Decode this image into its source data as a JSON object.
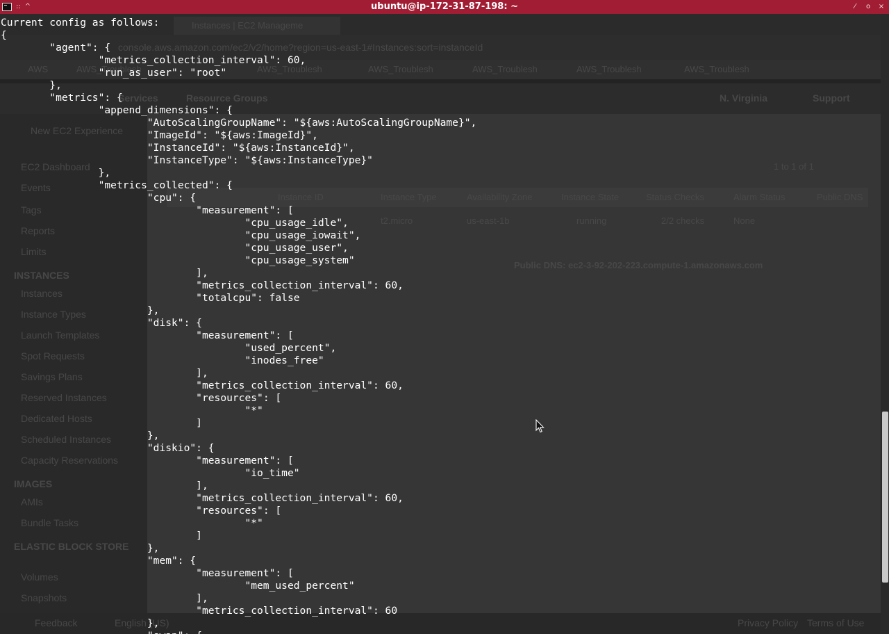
{
  "window": {
    "title": "ubuntu@ip-172-31-87-198: ~",
    "menu_glyph": "::",
    "pin_glyph": "^",
    "minimize_glyph": "⁄",
    "maximize_glyph": "o",
    "close_glyph": "×"
  },
  "terminal": {
    "lines": [
      "Current config as follows:",
      "{",
      "\t\"agent\": {",
      "\t\t\"metrics_collection_interval\": 60,",
      "\t\t\"run_as_user\": \"root\"",
      "\t},",
      "\t\"metrics\": {",
      "\t\t\"append_dimensions\": {",
      "\t\t\t\"AutoScalingGroupName\": \"${aws:AutoScalingGroupName}\",",
      "\t\t\t\"ImageId\": \"${aws:ImageId}\",",
      "\t\t\t\"InstanceId\": \"${aws:InstanceId}\",",
      "\t\t\t\"InstanceType\": \"${aws:InstanceType}\"",
      "\t\t},",
      "\t\t\"metrics_collected\": {",
      "\t\t\t\"cpu\": {",
      "\t\t\t\t\"measurement\": [",
      "\t\t\t\t\t\"cpu_usage_idle\",",
      "\t\t\t\t\t\"cpu_usage_iowait\",",
      "\t\t\t\t\t\"cpu_usage_user\",",
      "\t\t\t\t\t\"cpu_usage_system\"",
      "\t\t\t\t],",
      "\t\t\t\t\"metrics_collection_interval\": 60,",
      "\t\t\t\t\"totalcpu\": false",
      "\t\t\t},",
      "\t\t\t\"disk\": {",
      "\t\t\t\t\"measurement\": [",
      "\t\t\t\t\t\"used_percent\",",
      "\t\t\t\t\t\"inodes_free\"",
      "\t\t\t\t],",
      "\t\t\t\t\"metrics_collection_interval\": 60,",
      "\t\t\t\t\"resources\": [",
      "\t\t\t\t\t\"*\"",
      "\t\t\t\t]",
      "\t\t\t},",
      "\t\t\t\"diskio\": {",
      "\t\t\t\t\"measurement\": [",
      "\t\t\t\t\t\"io_time\"",
      "\t\t\t\t],",
      "\t\t\t\t\"metrics_collection_interval\": 60,",
      "\t\t\t\t\"resources\": [",
      "\t\t\t\t\t\"*\"",
      "\t\t\t\t]",
      "\t\t\t},",
      "\t\t\t\"mem\": {",
      "\t\t\t\t\"measurement\": [",
      "\t\t\t\t\t\"mem_used_percent\"",
      "\t\t\t\t],",
      "\t\t\t\t\"metrics_collection_interval\": 60",
      "\t\t\t},",
      "\t\t\t\"swap\": {"
    ]
  },
  "background_browser": {
    "tab_title": "Instances | EC2 Manageme",
    "url": "console.aws.amazon.com/ec2/v2/home?region=us-east-1#Instances:sort=instanceId",
    "bookmarks": [
      "AWS",
      "AWS_Troublesh",
      "AWS_Troublesh",
      "AWS_Troublesh",
      "AWS_Troublesh",
      "AWS_Troublesh",
      "AWS_Troublesh"
    ],
    "nav": [
      "Services",
      "Resource Groups"
    ],
    "nav_right": [
      "N. Virginia",
      "Support"
    ],
    "sidebar": {
      "top_items": [
        "New EC2 Experience",
        "EC2 Dashboard",
        "Events",
        "Tags",
        "Reports",
        "Limits"
      ],
      "instances_header": "INSTANCES",
      "instances_items": [
        "Instances",
        "Instance Types",
        "Launch Templates",
        "Spot Requests",
        "Savings Plans",
        "Reserved Instances",
        "Dedicated Hosts",
        "Scheduled Instances",
        "Capacity Reservations"
      ],
      "images_header": "IMAGES",
      "images_items": [
        "AMIs",
        "Bundle Tasks"
      ],
      "ebs_header": "ELASTIC BLOCK STORE",
      "ebs_items": [
        "Volumes",
        "Snapshots"
      ]
    },
    "table_headers": [
      "Instance ID",
      "Instance Type",
      "Availability Zone",
      "Instance State",
      "Status Checks",
      "Alarm Status",
      "Public DNS"
    ],
    "table_row": [
      "t2.micro",
      "us-east-1b",
      "running",
      "2/2 checks",
      "None"
    ],
    "pagination": "1 to 1 of 1",
    "public_dns_label": "Public DNS: ec2-3-92-202-223.compute-1.amazonaws.com",
    "footer": [
      "Feedback",
      "English (US)",
      "Privacy Policy",
      "Terms of Use"
    ]
  }
}
